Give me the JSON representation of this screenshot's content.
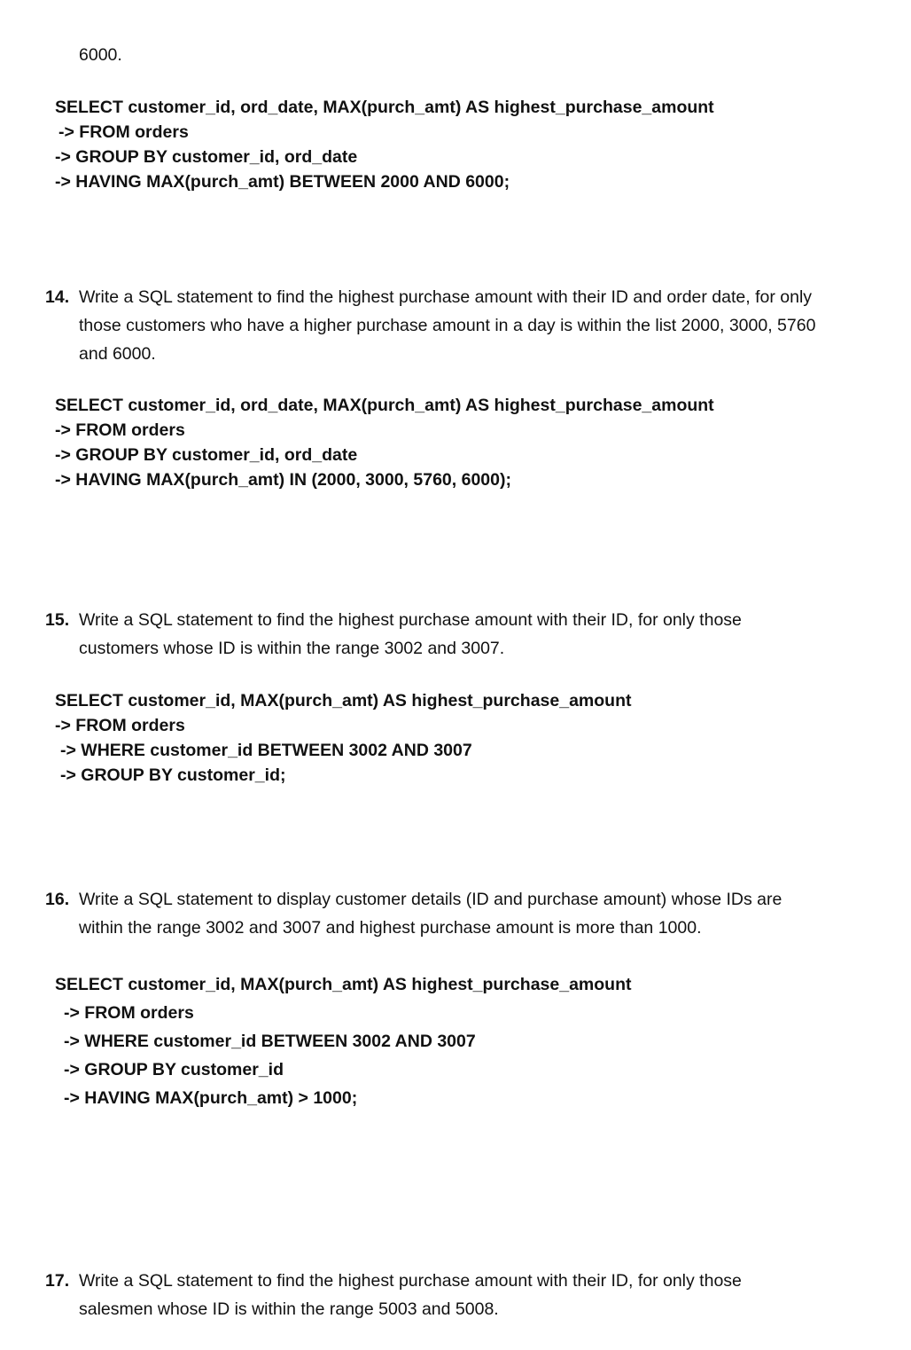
{
  "intro": {
    "tail": "6000."
  },
  "blocks": [
    {
      "code": [
        "SELECT customer_id, ord_date, MAX(purch_amt) AS highest_purchase_amount",
        "-> FROM orders",
        "-> GROUP BY customer_id, ord_date",
        "-> HAVING MAX(purch_amt) BETWEEN 2000 AND 6000;"
      ]
    }
  ],
  "questions": [
    {
      "number": "14.",
      "lines": [
        "Write a SQL statement to find the highest purchase amount with their ID and order date, for only",
        "those customers who have a higher purchase amount in a day is within the list 2000, 3000, 5760",
        "and 6000."
      ],
      "code": [
        "SELECT customer_id, ord_date, MAX(purch_amt) AS highest_purchase_amount",
        "-> FROM orders",
        "-> GROUP BY customer_id, ord_date",
        "-> HAVING MAX(purch_amt) IN (2000, 3000, 5760, 6000);"
      ]
    },
    {
      "number": "15.",
      "lines": [
        "Write a SQL statement to find the highest purchase amount with their ID, for only those",
        "customers whose ID is within the range 3002 and 3007."
      ],
      "code": [
        "SELECT customer_id, MAX(purch_amt) AS highest_purchase_amount",
        "-> FROM orders",
        "-> WHERE customer_id BETWEEN 3002 AND 3007",
        "-> GROUP BY customer_id;"
      ]
    },
    {
      "number": "16.",
      "lines": [
        "Write a SQL statement to display customer details (ID and purchase amount) whose IDs are",
        "within the range 3002 and 3007 and highest purchase amount is more than 1000."
      ],
      "code": [
        "SELECT customer_id, MAX(purch_amt) AS highest_purchase_amount",
        "-> FROM orders",
        "-> WHERE customer_id BETWEEN 3002 AND 3007",
        "-> GROUP BY customer_id",
        "-> HAVING MAX(purch_amt) > 1000;"
      ]
    },
    {
      "number": "17.",
      "lines": [
        "Write a SQL statement to find the highest purchase amount with their ID, for only those",
        "salesmen whose ID is within the range 5003 and 5008."
      ]
    }
  ]
}
